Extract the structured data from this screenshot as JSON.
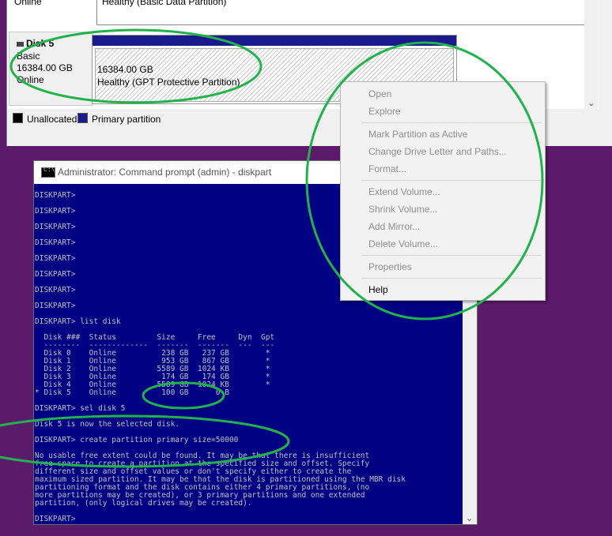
{
  "disk_management": {
    "prev_disk": {
      "status": "Online",
      "partition_status": "Healthy (Basic Data Partition)"
    },
    "disk5": {
      "name": "Disk 5",
      "type": "Basic",
      "size": "16384.00 GB",
      "status": "Online",
      "partition": {
        "size": "16384.00 GB",
        "status": "Healthy (GPT Protective Partition)"
      }
    },
    "legend": {
      "unallocated": "Unallocated",
      "primary": "Primary partition"
    }
  },
  "cmd": {
    "title": "Administrator: Command prompt  (admin) - diskpart",
    "icon_text": "C:\\",
    "lines": [
      "DISKPART>",
      "DISKPART>",
      "DISKPART>",
      "DISKPART>",
      "DISKPART>",
      "DISKPART>",
      "DISKPART>",
      "DISKPART>",
      "DISKPART> list disk",
      "  Disk ###  Status         Size     Free     Dyn  Gpt",
      "  --------  -------------  -------  -------  ---  ---",
      "  Disk 0    Online          238 GB   237 GB        *",
      "  Disk 1    Online          953 GB   867 GB        *",
      "  Disk 2    Online         5589 GB  1024 KB        *",
      "  Disk 3    Online          174 GB   174 GB        *",
      "  Disk 4    Online         5589 GB  1024 KB        *",
      "* Disk 5    Online          100 GB      0 B",
      "DISKPART> sel disk 5",
      "Disk 5 is now the selected disk.",
      "DISKPART> create partition primary size=50000",
      "No usable free extent could be found. It may be that there is insufficient",
      "free space to create a partition at the specified size and offset. Specify",
      "different size and offset values or don't specify either to create the",
      "maximum sized partition. It may be that the disk is partitioned using the MBR disk",
      "partitioning format and the disk contains either 4 primary partitions, (no",
      "more partitions may be created), or 3 primary partitions and one extended",
      "partition, (only logical drives may be created).",
      "DISKPART>"
    ]
  },
  "context_menu": {
    "items": [
      {
        "label": "Open",
        "enabled": false
      },
      {
        "label": "Explore",
        "enabled": false
      },
      {
        "label": "Mark Partition as Active",
        "enabled": false
      },
      {
        "label": "Change Drive Letter and Paths...",
        "enabled": false
      },
      {
        "label": "Format...",
        "enabled": false
      },
      {
        "label": "Extend Volume...",
        "enabled": false
      },
      {
        "label": "Shrink Volume...",
        "enabled": false
      },
      {
        "label": "Add Mirror...",
        "enabled": false
      },
      {
        "label": "Delete Volume...",
        "enabled": false
      },
      {
        "label": "Properties",
        "enabled": false
      },
      {
        "label": "Help",
        "enabled": true
      }
    ]
  },
  "colors": {
    "annotation": "#22b24c",
    "console_bg": "#000082",
    "console_text": "#c0c0c0",
    "primary_partition": "#1a1a8c",
    "desktop": "#5c1a6b"
  },
  "icons": {
    "disk": "disk-icon",
    "cmd": "cmd-icon",
    "scroll_down": "chevron-down-icon"
  }
}
